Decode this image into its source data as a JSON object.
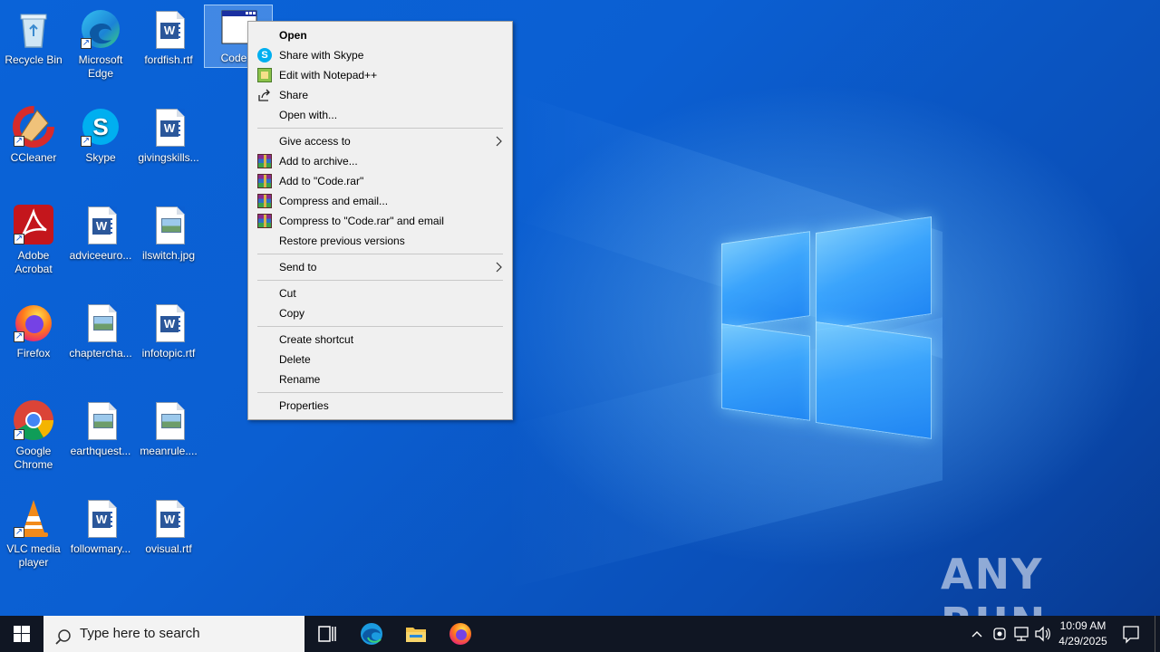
{
  "desktop": {
    "icons": [
      {
        "name": "recycle-bin",
        "label": "Recycle Bin"
      },
      {
        "name": "microsoft-edge",
        "label": "Microsoft Edge"
      },
      {
        "name": "fordfish",
        "label": "fordfish.rtf"
      },
      {
        "name": "code-file",
        "label": "Code.h"
      },
      {
        "name": "ccleaner",
        "label": "CCleaner"
      },
      {
        "name": "skype",
        "label": "Skype"
      },
      {
        "name": "givingskills",
        "label": "givingskills..."
      },
      {
        "name": "adobe-acrobat",
        "label": "Adobe Acrobat"
      },
      {
        "name": "adviceeuro",
        "label": "adviceeuro..."
      },
      {
        "name": "ilswitch",
        "label": "ilswitch.jpg"
      },
      {
        "name": "firefox",
        "label": "Firefox"
      },
      {
        "name": "chaptercha",
        "label": "chapterchа..."
      },
      {
        "name": "infotopic",
        "label": "infotopic.rtf"
      },
      {
        "name": "google-chrome",
        "label": "Google Chrome"
      },
      {
        "name": "earthquest",
        "label": "earthquest..."
      },
      {
        "name": "meanrule",
        "label": "meanrule...."
      },
      {
        "name": "vlc",
        "label": "VLC media player"
      },
      {
        "name": "followmary",
        "label": "followmary..."
      },
      {
        "name": "ovisual",
        "label": "ovisual.rtf"
      }
    ]
  },
  "context_menu": {
    "items": [
      {
        "label": "Open",
        "bold": true
      },
      {
        "label": "Share with Skype",
        "icon": "skype-icon"
      },
      {
        "label": "Edit with Notepad++",
        "icon": "notepadpp-icon"
      },
      {
        "label": "Share",
        "icon": "share-icon"
      },
      {
        "label": "Open with..."
      },
      {
        "label": "Give access to",
        "submenu": true
      },
      {
        "label": "Add to archive...",
        "icon": "winrar-icon"
      },
      {
        "label": "Add to \"Code.rar\"",
        "icon": "winrar-icon"
      },
      {
        "label": "Compress and email...",
        "icon": "winrar-icon"
      },
      {
        "label": "Compress to \"Code.rar\" and email",
        "icon": "winrar-icon"
      },
      {
        "label": "Restore previous versions"
      },
      {
        "label": "Send to",
        "submenu": true
      },
      {
        "label": "Cut"
      },
      {
        "label": "Copy"
      },
      {
        "label": "Create shortcut"
      },
      {
        "label": "Delete"
      },
      {
        "label": "Rename"
      },
      {
        "label": "Properties"
      }
    ]
  },
  "taskbar": {
    "search_placeholder": "Type here to search",
    "time": "10:09 AM",
    "date": "4/29/2025",
    "pinned": [
      "task-view-icon",
      "edge-icon",
      "file-explorer-icon",
      "firefox-icon"
    ]
  },
  "watermark": "ANY RUN",
  "colors": {
    "wallpaper": "#0a58c9",
    "taskbar": "#101623",
    "menu_bg": "#f0f0f0"
  }
}
